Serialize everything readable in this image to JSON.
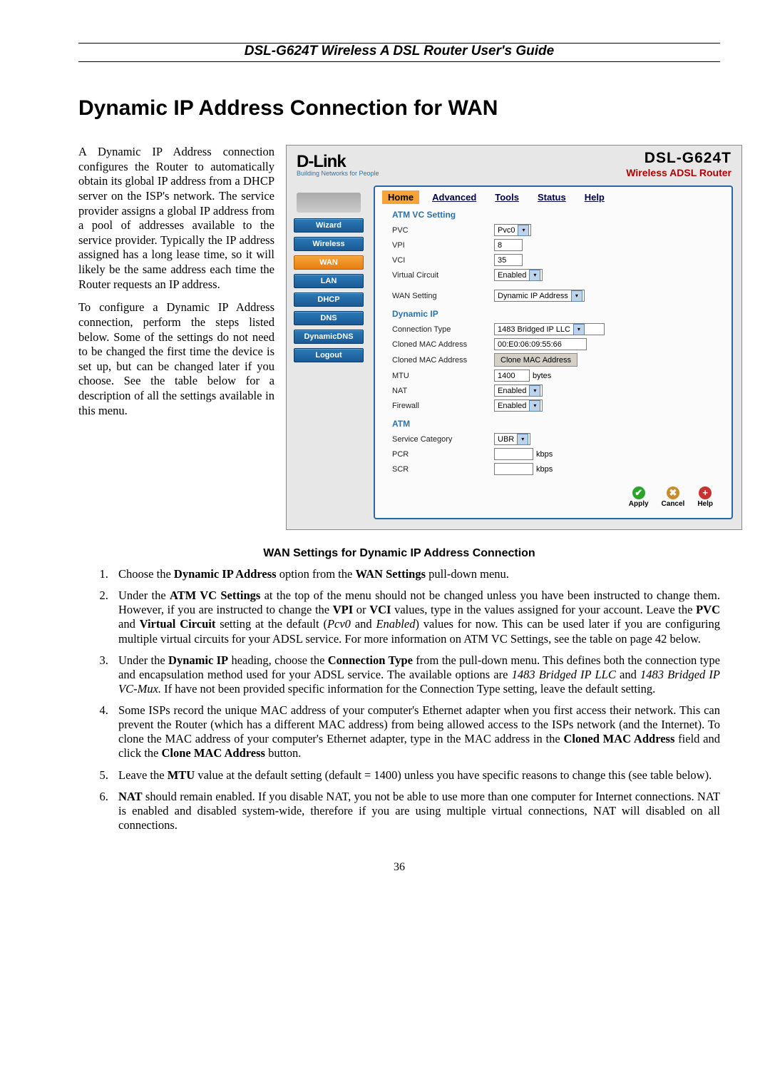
{
  "header": {
    "running_title": "DSL-G624T Wireless A DSL Router User's Guide"
  },
  "page": {
    "title": "Dynamic IP Address Connection for WAN",
    "number": "36"
  },
  "intro": {
    "p1": "A Dynamic IP Address connection configures the Router to automatically obtain its global IP address from a DHCP server on the ISP's network. The service provider assigns a global IP address from a pool of addresses available to the service provider. Typically the IP address assigned has a long lease time, so it will likely be the same address each time the Router requests an IP address.",
    "p2": "To configure a Dynamic IP Address connection, perform the steps listed below. Some of the settings do not need to be changed the first time the device is set up, but can be changed later if you choose. See the table below for a description of all the settings available in this menu."
  },
  "screenshot": {
    "brand_line1": "D-Link",
    "brand_line2": "Building Networks for People",
    "model_line1": "DSL-G624T",
    "model_line2": "Wireless ADSL Router",
    "tabs": [
      "Home",
      "Advanced",
      "Tools",
      "Status",
      "Help"
    ],
    "active_tab": "Home",
    "sidebar": [
      "Wizard",
      "Wireless",
      "WAN",
      "LAN",
      "DHCP",
      "DNS",
      "DynamicDNS",
      "Logout"
    ],
    "active_side": "WAN",
    "sections": {
      "atm_title": "ATM VC Setting",
      "pvc_label": "PVC",
      "pvc_value": "Pvc0",
      "vpi_label": "VPI",
      "vpi_value": "8",
      "vci_label": "VCI",
      "vci_value": "35",
      "vc_label": "Virtual Circuit",
      "vc_value": "Enabled",
      "wan_label": "WAN Setting",
      "wan_value": "Dynamic IP Address",
      "dyn_title": "Dynamic IP",
      "ct_label": "Connection Type",
      "ct_value": "1483 Bridged IP LLC",
      "cmac1_label": "Cloned MAC Address",
      "cmac1_value": "00:E0:06:09:55:66",
      "cmac2_label": "Cloned MAC Address",
      "cmac2_btn": "Clone MAC Address",
      "mtu_label": "MTU",
      "mtu_value": "1400",
      "mtu_unit": "bytes",
      "nat_label": "NAT",
      "nat_value": "Enabled",
      "fw_label": "Firewall",
      "fw_value": "Enabled",
      "atm2_title": "ATM",
      "svc_label": "Service Category",
      "svc_value": "UBR",
      "pcr_label": "PCR",
      "pcr_unit": "kbps",
      "scr_label": "SCR",
      "scr_unit": "kbps"
    },
    "actions": {
      "apply": "Apply",
      "cancel": "Cancel",
      "help": "Help"
    }
  },
  "caption": "WAN Settings for Dynamic IP Address Connection",
  "steps": {
    "s1a": "Choose the ",
    "s1b": "Dynamic IP Address",
    "s1c": " option from the ",
    "s1d": "WAN Settings",
    "s1e": " pull-down menu.",
    "s2a": "Under the ",
    "s2b": "ATM VC Settings",
    "s2c": " at the top of the menu should not be changed unless you have been instructed to change them. However, if you are instructed to change the ",
    "s2d": "VPI",
    "s2e": " or ",
    "s2f": "VCI",
    "s2g": " values, type in the values assigned for your account. Leave the ",
    "s2h": "PVC",
    "s2i": " and ",
    "s2j": "Virtual Circuit",
    "s2k": " setting at the default (",
    "s2l": "Pcv0",
    "s2m": " and ",
    "s2n": "Enabled",
    "s2o": ") values for now. This can be used later if you are configuring multiple virtual circuits for your ADSL service. For more information on ATM VC Settings, see the table on page 42 below.",
    "s3a": "Under the ",
    "s3b": "Dynamic IP",
    "s3c": " heading, choose the ",
    "s3d": "Connection Type",
    "s3e": " from the pull-down menu. This defines both the connection type and encapsulation method used for your ADSL service. The available options are ",
    "s3f": "1483 Bridged IP LLC",
    "s3g": " and ",
    "s3h": "1483 Bridged IP VC-Mux.",
    "s3i": " If have not been provided specific information for the Connection Type setting, leave the default setting.",
    "s4a": "Some ISPs record the unique MAC address of your computer's Ethernet adapter when you first access their network. This can prevent the Router (which has a different MAC address) from being allowed access to the ISPs network (and the Internet). To clone the MAC address of your computer's Ethernet adapter, type in the MAC address in the ",
    "s4b": "Cloned MAC Address",
    "s4c": " field and click the ",
    "s4d": "Clone MAC Address",
    "s4e": " button.",
    "s5a": "Leave the ",
    "s5b": "MTU",
    "s5c": " value at the default setting (default = 1400) unless you have specific reasons to change this (see table below).",
    "s6a": "NAT",
    "s6b": " should remain enabled. If you disable NAT, you not be able to use more than one computer for Internet connections. NAT is enabled and disabled system-wide, therefore if you are using multiple virtual connections, NAT will disabled on all connections."
  }
}
